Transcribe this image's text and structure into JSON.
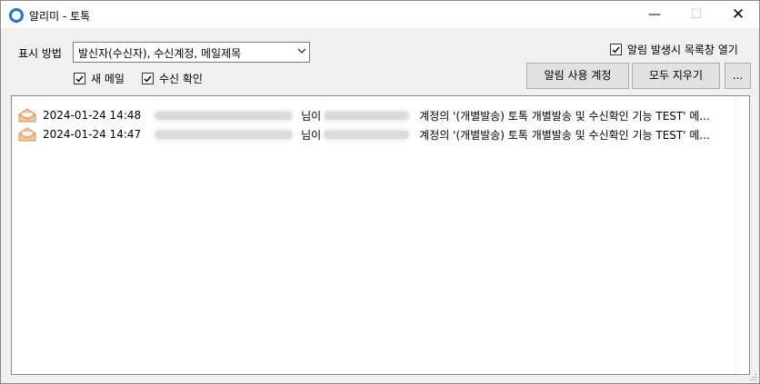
{
  "window": {
    "title": "알리미 - 토톡",
    "minimize_glyph": "—",
    "maximize_glyph": "☐",
    "close_glyph": "✕"
  },
  "display": {
    "label": "표시 방법",
    "selected": "발신자(수신자), 수신계정, 메일제목"
  },
  "options": {
    "new_mail": {
      "label": "새 메일",
      "checked": true
    },
    "read_receipt": {
      "label": "수신 확인",
      "checked": true
    },
    "open_list_on_alert": {
      "label": "알림 발생시 목록창 열기",
      "checked": true
    }
  },
  "buttons": {
    "alert_accounts": "알림 사용 계정",
    "clear_all": "모두 지우기",
    "more": "..."
  },
  "notifications": [
    {
      "time": "2024-01-24 14:48",
      "suffix1": "님이",
      "message": "계정의 '(개별발송) 토톡 개별발송 및 수신확인 기능 TEST' 메..."
    },
    {
      "time": "2024-01-24 14:47",
      "suffix1": "님이",
      "message": "계정의 '(개별발송) 토톡 개별발송 및 수신확인 기능 TEST' 메..."
    }
  ],
  "icons": {
    "app": "app-ring-icon",
    "mail": "open-envelope-icon",
    "dropdown": "chevron-down-icon",
    "check": "check-icon",
    "resize": "resize-grip-icon"
  },
  "colors": {
    "accent": "#1e73e6",
    "envelope": "#e8a060",
    "button_face": "#e1e1e1"
  }
}
